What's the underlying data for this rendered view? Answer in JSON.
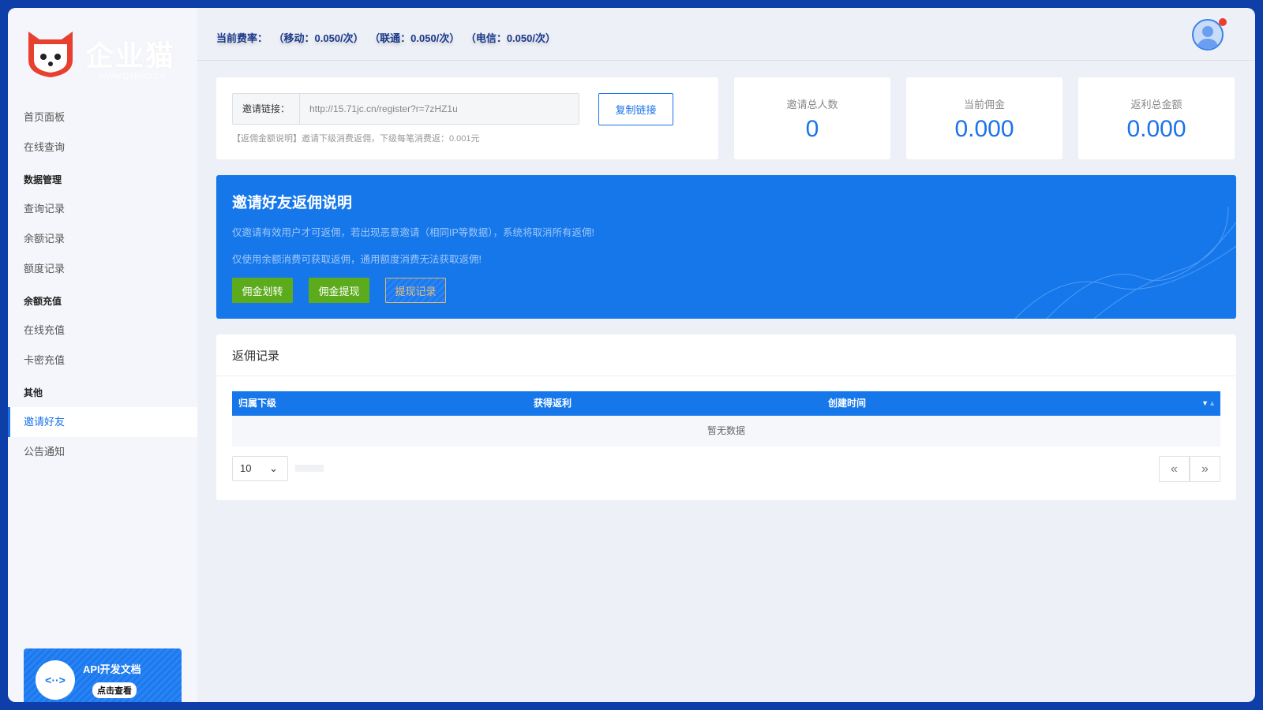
{
  "logo": {
    "name": "企业猫",
    "url": "WWW.QYMAO.CN"
  },
  "sidebar": {
    "items": [
      {
        "type": "item",
        "label": "首页面板"
      },
      {
        "type": "item",
        "label": "在线查询"
      },
      {
        "type": "group",
        "label": "数据管理"
      },
      {
        "type": "item",
        "label": "查询记录"
      },
      {
        "type": "item",
        "label": "余额记录"
      },
      {
        "type": "item",
        "label": "额度记录"
      },
      {
        "type": "group",
        "label": "余额充值"
      },
      {
        "type": "item",
        "label": "在线充值"
      },
      {
        "type": "item",
        "label": "卡密充值"
      },
      {
        "type": "group",
        "label": "其他"
      },
      {
        "type": "item",
        "label": "邀请好友",
        "active": true
      },
      {
        "type": "item",
        "label": "公告通知"
      }
    ],
    "api": {
      "title": "API开发文档",
      "button": "点击查看",
      "icon": "<··>"
    }
  },
  "header": {
    "rate_label": "当前费率：",
    "mobile": "（移动：0.050/次）",
    "unicom": "（联通：0.050/次）",
    "telecom": "（电信：0.050/次）"
  },
  "invite": {
    "label": "邀请链接：",
    "link": "http://15.71jc.cn/register?r=7zHZ1u",
    "copy": "复制链接",
    "note": "【返佣金额说明】邀请下级消费返佣，下级每笔消费返：0.001元"
  },
  "stats": [
    {
      "label": "邀请总人数",
      "value": "0"
    },
    {
      "label": "当前佣金",
      "value": "0.000"
    },
    {
      "label": "返利总金额",
      "value": "0.000"
    }
  ],
  "banner": {
    "title": "邀请好友返佣说明",
    "line1": "仅邀请有效用户才可返佣，若出现恶意邀请（相同IP等数据），系统将取消所有返佣!",
    "line2": "仅使用余额消费可获取返佣，通用额度消费无法获取返佣!",
    "btn1": "佣金划转",
    "btn2": "佣金提现",
    "btn3": "提现记录"
  },
  "records": {
    "title": "返佣记录",
    "columns": [
      "归属下级",
      "获得返利",
      "创建时间"
    ],
    "empty": "暂无数据",
    "page_size": "10",
    "prev": "«",
    "next": "»"
  },
  "colors": {
    "primary": "#1677ea",
    "green": "#5cab1d",
    "frame": "#0e3ea8"
  }
}
